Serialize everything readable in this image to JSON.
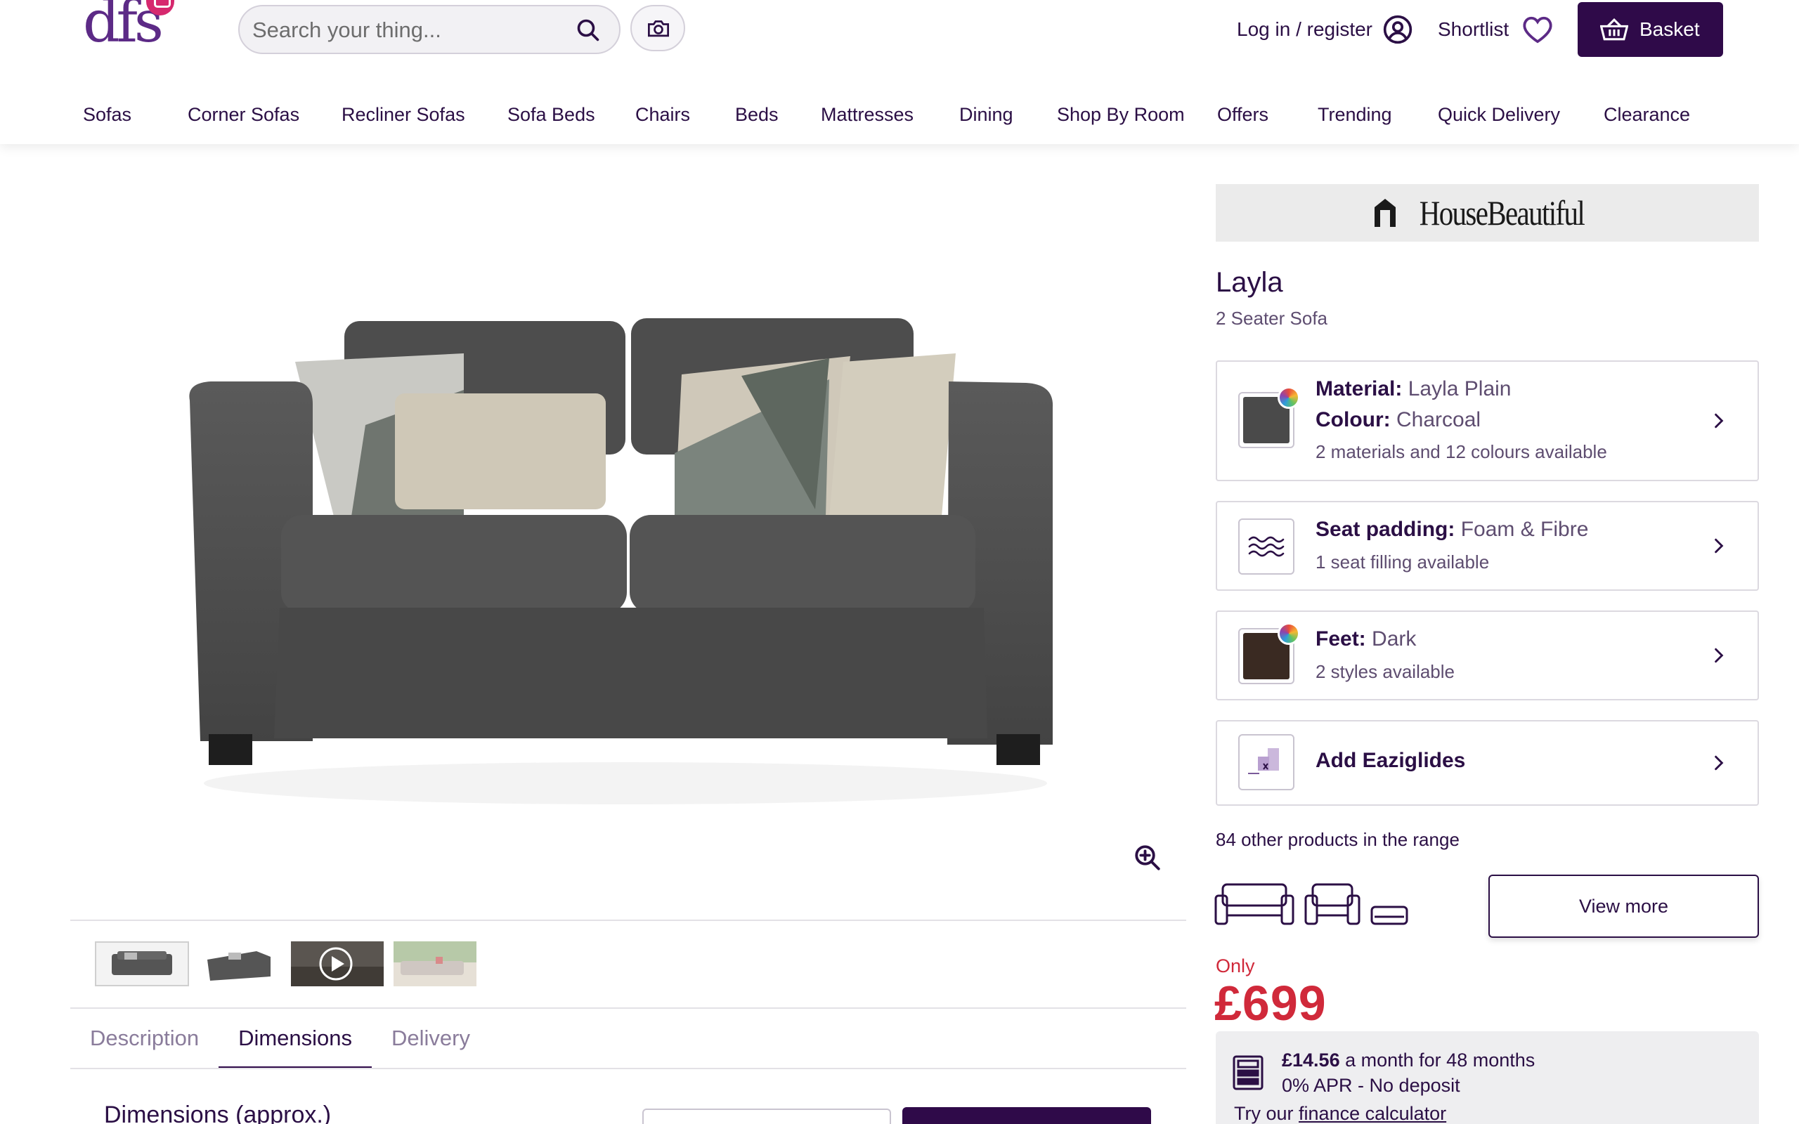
{
  "header": {
    "logo_text": "dfs",
    "search_placeholder": "Search your thing...",
    "login_label": "Log in / register",
    "shortlist_label": "Shortlist",
    "basket_label": "Basket"
  },
  "nav": {
    "items": [
      "Sofas",
      "Corner Sofas",
      "Recliner Sofas",
      "Sofa Beds",
      "Chairs",
      "Beds",
      "Mattresses",
      "Dining",
      "Shop By Room",
      "Offers",
      "Trending",
      "Quick Delivery",
      "Clearance"
    ]
  },
  "gallery": {
    "thumbnails": [
      "front view",
      "angle view",
      "video",
      "room view"
    ]
  },
  "tabs": {
    "items": [
      "Description",
      "Dimensions",
      "Delivery"
    ],
    "active": "Dimensions",
    "section_title": "Dimensions (approx.)"
  },
  "product": {
    "brand": "HouseBeautiful",
    "name": "Layla",
    "type": "2 Seater Sofa",
    "material_label": "Material:",
    "material_value": "Layla Plain",
    "colour_label": "Colour:",
    "colour_value": "Charcoal",
    "colour_hex": "#4a4a4a",
    "material_sub": "2 materials and 12 colours available",
    "padding_label": "Seat padding:",
    "padding_value": "Foam & Fibre",
    "padding_sub": "1 seat filling available",
    "feet_label": "Feet:",
    "feet_value": "Dark",
    "feet_hex": "#3a2a22",
    "feet_sub": "2 styles available",
    "addon_label": "Add Eaziglides",
    "range_text": "84 other products in the range",
    "view_more": "View more",
    "price_prefix": "Only",
    "price": "£699",
    "finance_amount": "£14.56",
    "finance_terms": "a month for 48 months",
    "finance_apr": "0% APR - No deposit",
    "finance_try": "Try our",
    "finance_link": "finance calculator"
  },
  "colors": {
    "brand_purple": "#2f0a49",
    "price_red": "#d0293a",
    "logo_purple": "#5c2a86",
    "logo_pink": "#d6286e"
  }
}
